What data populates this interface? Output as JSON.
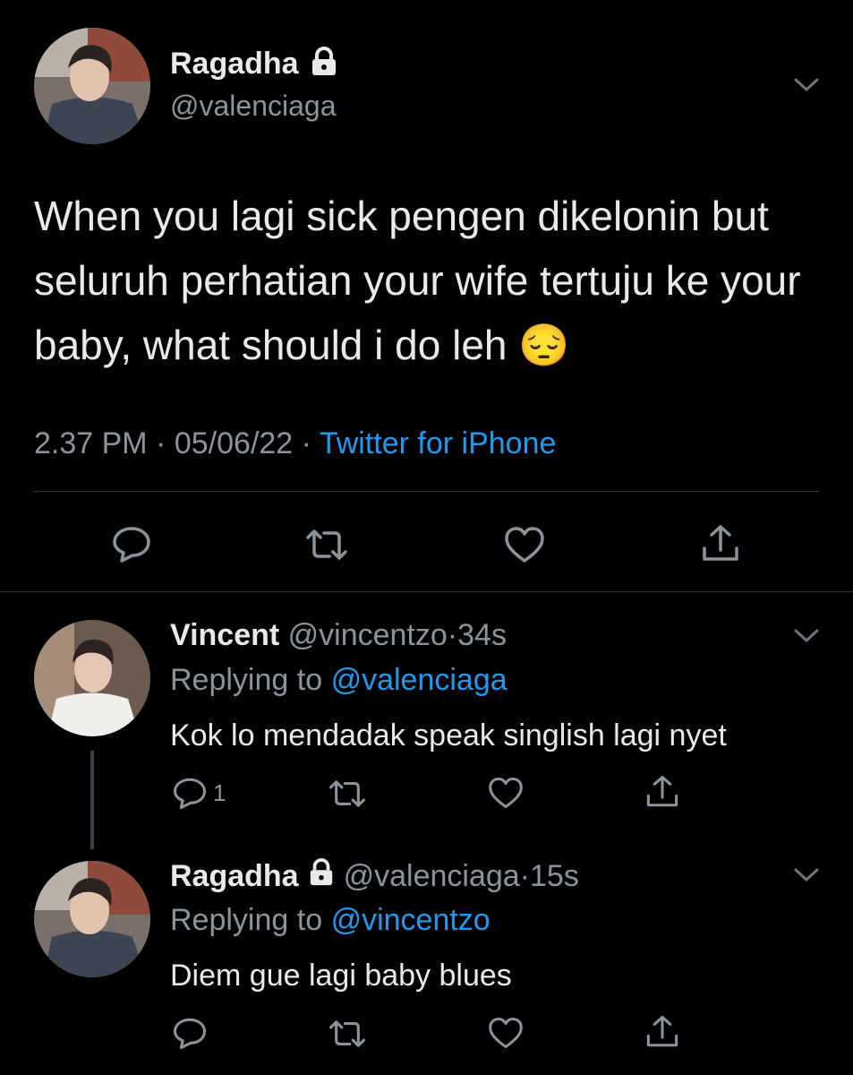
{
  "main_tweet": {
    "name": "Ragadha",
    "handle": "@valenciaga",
    "text": "When you lagi sick pengen dikelonin but seluruh perhatian your wife tertuju ke your baby, what should i do leh 😔",
    "time": "2.37 PM",
    "dot1": "·",
    "date": "05/06/22",
    "dot2": "·",
    "source": "Twitter for iPhone"
  },
  "replies": [
    {
      "name": "Vincent",
      "handle": "@vincentzo",
      "sep": "·",
      "time": "34s",
      "replying_prefix": "Replying to",
      "replying_to": "@valenciaga",
      "text": "Kok lo mendadak speak singlish lagi nyet",
      "reply_count": "1"
    },
    {
      "name": "Ragadha",
      "handle": "@valenciaga",
      "sep": "·",
      "time": "15s",
      "replying_prefix": "Replying to",
      "replying_to": "@vincentzo",
      "text": "Diem gue lagi baby blues"
    }
  ],
  "icons": [
    "chevron-down-icon",
    "lock-icon",
    "reply-icon",
    "retweet-icon",
    "like-icon",
    "share-icon"
  ],
  "colors": {
    "background": "#000000",
    "link": "#1d9bf0",
    "muted": "#8b949c",
    "text": "#e7e9ea"
  }
}
